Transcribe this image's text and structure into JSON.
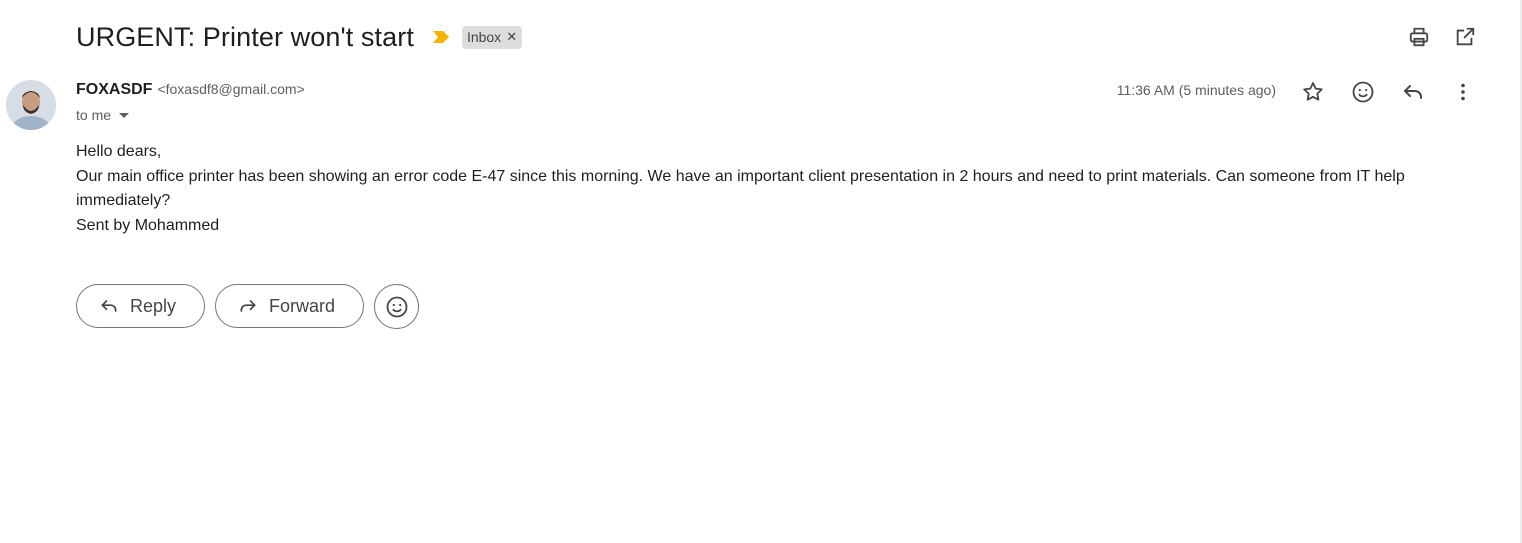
{
  "email": {
    "subject": "URGENT: Printer won't start",
    "label": "Inbox",
    "sender_name": "FOXASDF",
    "sender_email": "<foxasdf8@gmail.com>",
    "recipient": "to me",
    "timestamp": "11:36 AM (5 minutes ago)",
    "body": [
      "Hello dears,",
      "Our main office printer has been showing an error code E-47 since this morning. We have an important client presentation in 2 hours and need to print materials. Can someone from IT help immediately?",
      "Sent by Mohammed"
    ]
  },
  "actions": {
    "reply_label": "Reply",
    "forward_label": "Forward"
  },
  "icons": {
    "importance": "importance-marker-icon",
    "print": "print-icon",
    "new_window": "open-in-new-window-icon",
    "star": "star-icon",
    "emoji": "emoji-icon",
    "reply": "reply-icon",
    "more": "more-vert-icon",
    "forward": "forward-icon"
  },
  "colors": {
    "importance": "#f4b400",
    "label_bg": "#dddddd",
    "text": "#1f1f1f",
    "muted": "#5e5e5e"
  }
}
